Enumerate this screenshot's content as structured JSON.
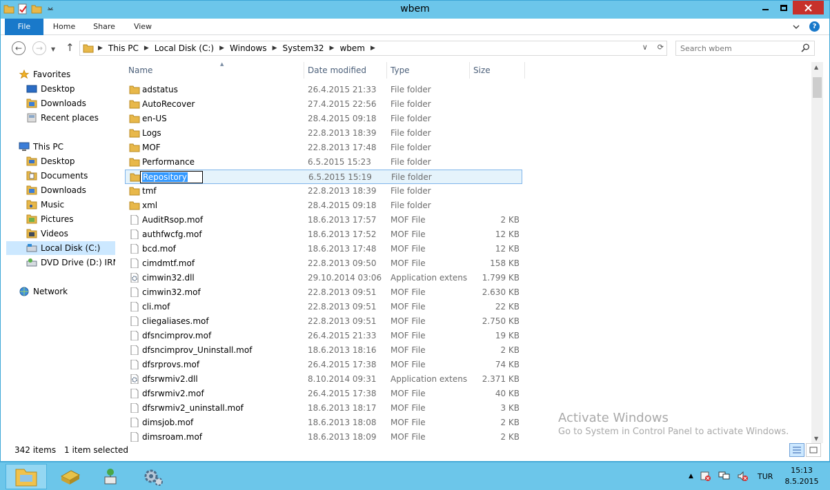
{
  "window": {
    "title": "wbem"
  },
  "ribbon": {
    "tabs": [
      {
        "label": "File"
      },
      {
        "label": "Home"
      },
      {
        "label": "Share"
      },
      {
        "label": "View"
      }
    ],
    "help": "?"
  },
  "address": {
    "crumbs": [
      "This PC",
      "Local Disk (C:)",
      "Windows",
      "System32",
      "wbem"
    ]
  },
  "search": {
    "placeholder": "Search wbem"
  },
  "nav": {
    "favorites": {
      "label": "Favorites",
      "items": [
        "Desktop",
        "Downloads",
        "Recent places"
      ]
    },
    "this_pc": {
      "label": "This PC",
      "items": [
        "Desktop",
        "Documents",
        "Downloads",
        "Music",
        "Pictures",
        "Videos",
        "Local Disk (C:)",
        "DVD Drive (D:) IRM_S"
      ]
    },
    "network": {
      "label": "Network"
    }
  },
  "columns": {
    "name": "Name",
    "date": "Date modified",
    "type": "Type",
    "size": "Size"
  },
  "files": [
    {
      "name": "adstatus",
      "date": "26.4.2015 21:33",
      "type": "File folder",
      "size": "",
      "kind": "folder"
    },
    {
      "name": "AutoRecover",
      "date": "27.4.2015 22:56",
      "type": "File folder",
      "size": "",
      "kind": "folder"
    },
    {
      "name": "en-US",
      "date": "28.4.2015 09:18",
      "type": "File folder",
      "size": "",
      "kind": "folder"
    },
    {
      "name": "Logs",
      "date": "22.8.2013 18:39",
      "type": "File folder",
      "size": "",
      "kind": "folder"
    },
    {
      "name": "MOF",
      "date": "22.8.2013 17:48",
      "type": "File folder",
      "size": "",
      "kind": "folder"
    },
    {
      "name": "Performance",
      "date": "6.5.2015 15:23",
      "type": "File folder",
      "size": "",
      "kind": "folder"
    },
    {
      "name": "Repository",
      "date": "6.5.2015 15:19",
      "type": "File folder",
      "size": "",
      "kind": "folder",
      "selected": true
    },
    {
      "name": "tmf",
      "date": "22.8.2013 18:39",
      "type": "File folder",
      "size": "",
      "kind": "folder"
    },
    {
      "name": "xml",
      "date": "28.4.2015 09:18",
      "type": "File folder",
      "size": "",
      "kind": "folder"
    },
    {
      "name": "AuditRsop.mof",
      "date": "18.6.2013 17:57",
      "type": "MOF File",
      "size": "2 KB",
      "kind": "file"
    },
    {
      "name": "authfwcfg.mof",
      "date": "18.6.2013 17:52",
      "type": "MOF File",
      "size": "12 KB",
      "kind": "file"
    },
    {
      "name": "bcd.mof",
      "date": "18.6.2013 17:48",
      "type": "MOF File",
      "size": "12 KB",
      "kind": "file"
    },
    {
      "name": "cimdmtf.mof",
      "date": "22.8.2013 09:50",
      "type": "MOF File",
      "size": "158 KB",
      "kind": "file"
    },
    {
      "name": "cimwin32.dll",
      "date": "29.10.2014 03:06",
      "type": "Application extens...",
      "size": "1.799 KB",
      "kind": "dll"
    },
    {
      "name": "cimwin32.mof",
      "date": "22.8.2013 09:51",
      "type": "MOF File",
      "size": "2.630 KB",
      "kind": "file"
    },
    {
      "name": "cli.mof",
      "date": "22.8.2013 09:51",
      "type": "MOF File",
      "size": "22 KB",
      "kind": "file"
    },
    {
      "name": "cliegaliases.mof",
      "date": "22.8.2013 09:51",
      "type": "MOF File",
      "size": "2.750 KB",
      "kind": "file"
    },
    {
      "name": "dfsncimprov.mof",
      "date": "26.4.2015 21:33",
      "type": "MOF File",
      "size": "19 KB",
      "kind": "file"
    },
    {
      "name": "dfsncimprov_Uninstall.mof",
      "date": "18.6.2013 18:16",
      "type": "MOF File",
      "size": "2 KB",
      "kind": "file"
    },
    {
      "name": "dfsrprovs.mof",
      "date": "26.4.2015 17:38",
      "type": "MOF File",
      "size": "74 KB",
      "kind": "file"
    },
    {
      "name": "dfsrwmiv2.dll",
      "date": "8.10.2014 09:31",
      "type": "Application extens...",
      "size": "2.371 KB",
      "kind": "dll"
    },
    {
      "name": "dfsrwmiv2.mof",
      "date": "26.4.2015 17:38",
      "type": "MOF File",
      "size": "40 KB",
      "kind": "file"
    },
    {
      "name": "dfsrwmiv2_uninstall.mof",
      "date": "18.6.2013 18:17",
      "type": "MOF File",
      "size": "3 KB",
      "kind": "file"
    },
    {
      "name": "dimsjob.mof",
      "date": "18.6.2013 18:08",
      "type": "MOF File",
      "size": "2 KB",
      "kind": "file"
    },
    {
      "name": "dimsroam.mof",
      "date": "18.6.2013 18:09",
      "type": "MOF File",
      "size": "2 KB",
      "kind": "file"
    }
  ],
  "status": {
    "count": "342 items",
    "selection": "1 item selected"
  },
  "activation": {
    "line1": "Activate Windows",
    "line2": "Go to System in Control Panel to activate Windows."
  },
  "taskbar": {
    "lang": "TUR",
    "time": "15:13",
    "date": "8.5.2015"
  },
  "colors": {
    "titlebar": "#6cc6ea",
    "file_tab": "#1979ca",
    "selection": "#e5f3fb",
    "close": "#c7312b"
  }
}
